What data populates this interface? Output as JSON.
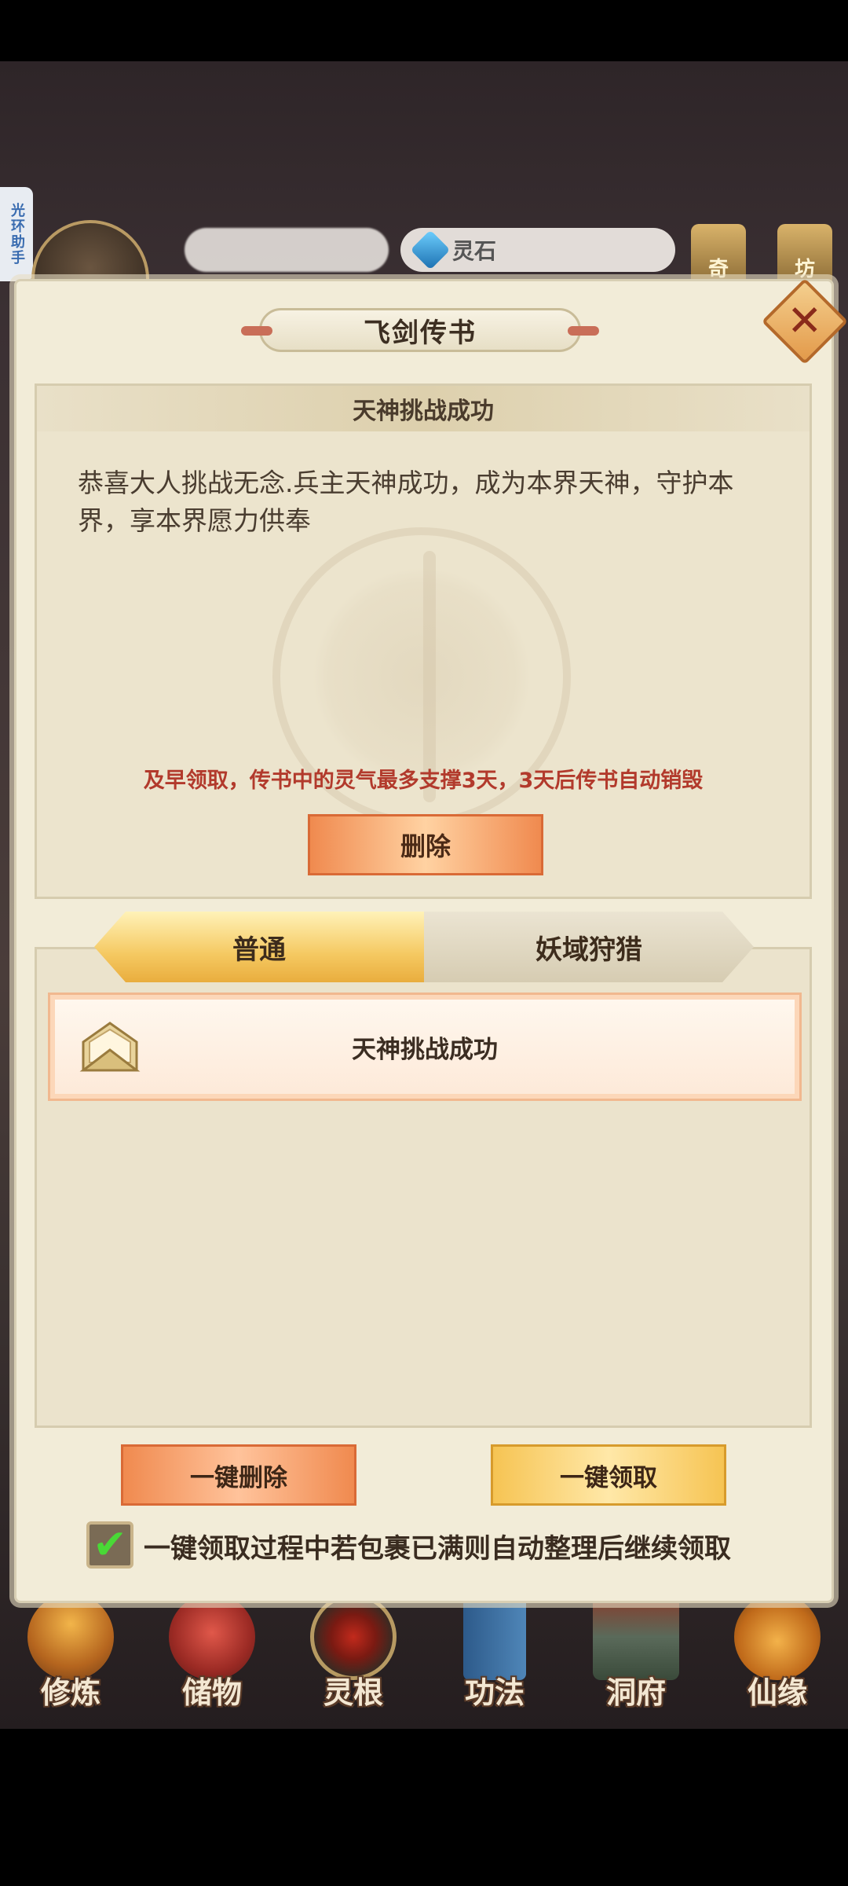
{
  "hud": {
    "resource_label": "灵石",
    "btn_qi": "奇",
    "btn_fang": "坊",
    "side_tab": "光环助手"
  },
  "panel": {
    "title": "飞剑传书"
  },
  "mail_detail": {
    "title": "天神挑战成功",
    "body": "恭喜大人挑战无念.兵主天神成功，成为本界天神，守护本界，享本界愿力供奉",
    "warning": "及早领取，传书中的灵气最多支撑3天，3天后传书自动销毁",
    "delete_label": "删除"
  },
  "tabs": [
    {
      "label": "普通",
      "active": true
    },
    {
      "label": "妖域狩猎",
      "active": false
    }
  ],
  "mail_list": [
    {
      "title": "天神挑战成功",
      "icon": "envelope-icon"
    }
  ],
  "actions": {
    "delete_all": "一键删除",
    "claim_all": "一键领取",
    "auto_sort_checked": true,
    "auto_sort_label": "一键领取过程中若包裹已满则自动整理后继续领取"
  },
  "bottom_nav": [
    {
      "label": "修炼",
      "icon": "cultivation-icon"
    },
    {
      "label": "储物",
      "icon": "storage-bag-icon"
    },
    {
      "label": "灵根",
      "icon": "spirit-root-icon"
    },
    {
      "label": "功法",
      "icon": "scripture-icon"
    },
    {
      "label": "洞府",
      "icon": "cave-palace-icon"
    },
    {
      "label": "仙缘",
      "icon": "immortal-gourd-icon"
    }
  ],
  "colors": {
    "panel_bg": "#f2ecd8",
    "warning": "#b23a2c",
    "active_tab": "#f5c962",
    "delete_btn": "#f08a4f",
    "claim_btn": "#f6c453",
    "check_green": "#49d936"
  }
}
